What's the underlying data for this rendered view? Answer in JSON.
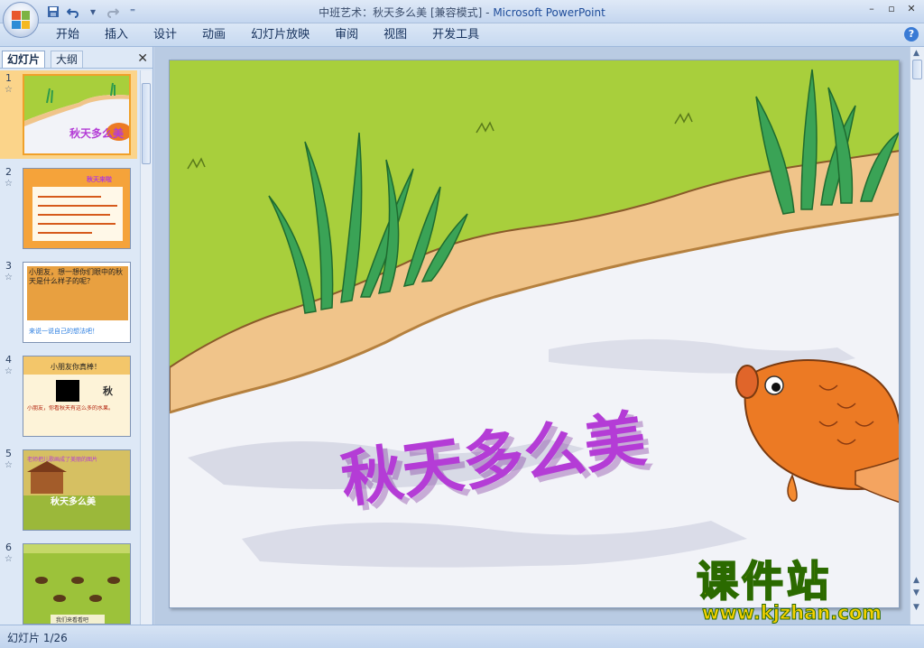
{
  "window": {
    "title": "中班艺术：秋天多么美 [兼容模式]",
    "app_name": "Microsoft PowerPoint",
    "separator": " - ",
    "controls": [
      "–",
      "▫",
      "✕"
    ]
  },
  "quick_access": {
    "icons": [
      "save-icon",
      "undo-icon",
      "redo-icon",
      "customize-icon"
    ]
  },
  "ribbon": {
    "tabs": [
      "开始",
      "插入",
      "设计",
      "动画",
      "幻灯片放映",
      "审阅",
      "视图",
      "开发工具"
    ],
    "help": "?"
  },
  "left_pane": {
    "tabs": [
      "幻灯片",
      "大纲"
    ],
    "close": "✕",
    "slides": [
      {
        "number": "1",
        "title": "秋天多么美",
        "selected": true
      },
      {
        "number": "2",
        "title": "秋天来啦"
      },
      {
        "number": "3",
        "title": "小朋友，想一想你们眼中的秋天是什么样子的呢？",
        "caption": "来说一说自己的想法吧！"
      },
      {
        "number": "4",
        "title": "小朋友你真棒！",
        "body": "小朋友，你看秋天有这么多的水果。"
      },
      {
        "number": "5",
        "title": "老师把儿歌画成了美丽的图片",
        "caption": "秋天多么美"
      },
      {
        "number": "6",
        "caption": "我们来看看吧"
      }
    ]
  },
  "slide": {
    "title": "秋天多么美"
  },
  "watermark": {
    "main": "课件站",
    "url": "www.kjzhan.com"
  },
  "status_bar": {
    "slide_counter": "幻灯片 1/26"
  },
  "colors": {
    "grass": "#a8cf3c",
    "bank": "#f0c48a",
    "snow": "#f2f3f8",
    "title_purple": "#b43cd6",
    "fish": "#ec7a24"
  }
}
